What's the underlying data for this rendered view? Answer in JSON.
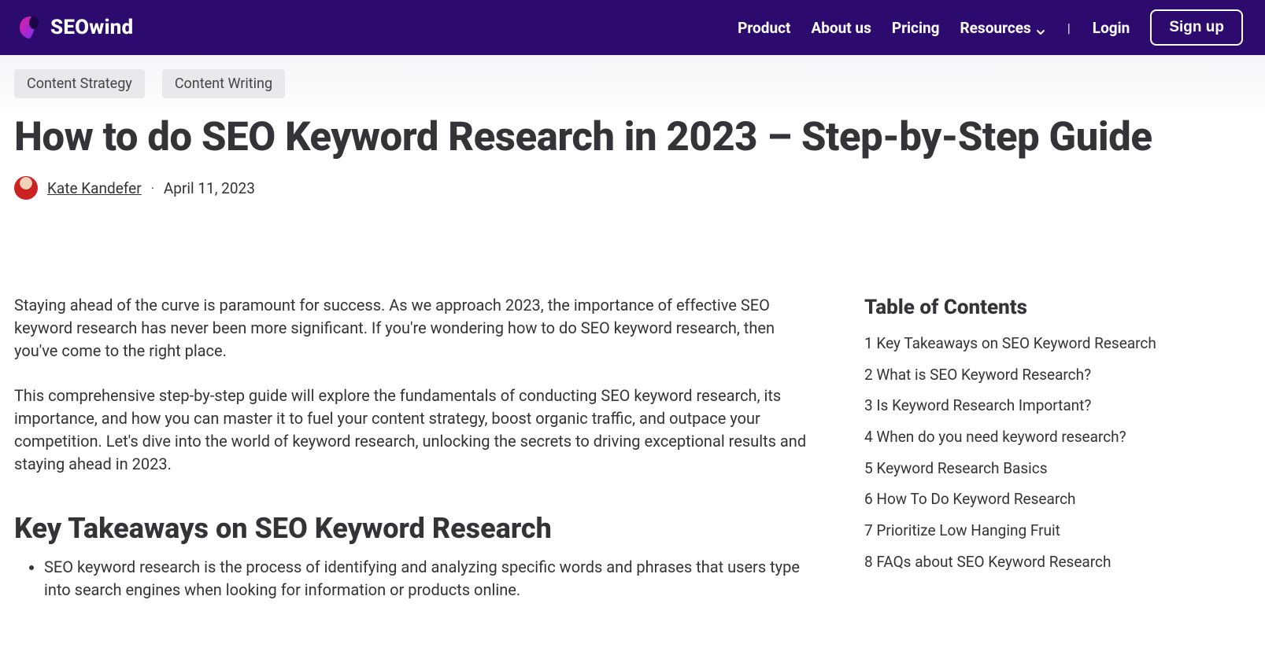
{
  "header": {
    "brand": "SEOwind",
    "nav": {
      "product": "Product",
      "about": "About us",
      "pricing": "Pricing",
      "resources": "Resources",
      "login": "Login",
      "signup": "Sign up",
      "separator": "|"
    }
  },
  "tags": {
    "strategy": "Content Strategy",
    "writing": "Content Writing"
  },
  "title": "How to do SEO Keyword Research in 2023 – Step-by-Step Guide",
  "author": "Kate Kandefer",
  "date": "April 11, 2023",
  "dot": "·",
  "article": {
    "p1": "Staying ahead of the curve is paramount for success. As we approach 2023, the importance of effective SEO keyword research has never been more significant. If you're wondering how to do SEO keyword research, then you've come to the right place.",
    "p2": "This comprehensive step-by-step guide will explore the fundamentals of conducting SEO keyword research, its importance, and how you can master it to fuel your content strategy, boost organic traffic, and outpace your competition. Let's dive into the world of keyword research, unlocking the secrets to driving exceptional results and staying ahead in 2023.",
    "h2": "Key Takeaways on SEO Keyword Research",
    "li1": "SEO keyword research is the process of identifying and analyzing specific words and phrases that users type into search engines when looking for information or products online."
  },
  "toc": {
    "title": "Table of Contents",
    "items": [
      "1 Key Takeaways on SEO Keyword Research",
      "2 What is SEO Keyword Research?",
      "3 Is Keyword Research Important?",
      "4 When do you need keyword research?",
      "5 Keyword Research Basics",
      "6 How To Do Keyword Research",
      "7 Prioritize Low Hanging Fruit",
      "8 FAQs about SEO Keyword Research"
    ]
  }
}
